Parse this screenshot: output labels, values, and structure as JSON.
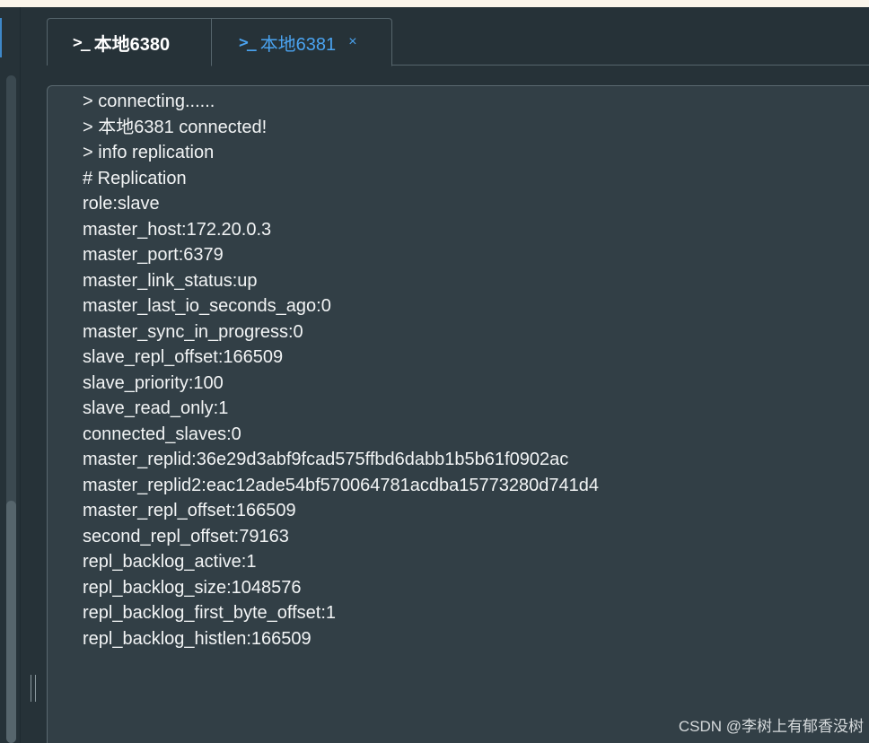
{
  "tabs": [
    {
      "icon": "terminal-icon",
      "icon_glyph": ">_",
      "label": "本地6380",
      "active": false
    },
    {
      "icon": "terminal-icon",
      "icon_glyph": ">_",
      "label": "本地6381",
      "active": true,
      "close_glyph": "×"
    }
  ],
  "console": {
    "lines": [
      "> connecting......",
      "> 本地6381 connected!",
      "> info replication",
      "# Replication",
      "role:slave",
      "master_host:172.20.0.3",
      "master_port:6379",
      "master_link_status:up",
      "master_last_io_seconds_ago:0",
      "master_sync_in_progress:0",
      "slave_repl_offset:166509",
      "slave_priority:100",
      "slave_read_only:1",
      "connected_slaves:0",
      "master_replid:36e29d3abf9fcad575ffbd6dabb1b5b61f0902ac",
      "master_replid2:eac12ade54bf570064781acdba15773280d741d4",
      "master_repl_offset:166509",
      "second_repl_offset:79163",
      "repl_backlog_active:1",
      "repl_backlog_size:1048576",
      "repl_backlog_first_byte_offset:1",
      "repl_backlog_histlen:166509"
    ]
  },
  "watermark": "CSDN @李树上有郁香没树",
  "colors": {
    "background": "#263238",
    "console_bg": "#323f46",
    "active_tab": "#4aa3f0",
    "text": "#f2f4f5"
  }
}
